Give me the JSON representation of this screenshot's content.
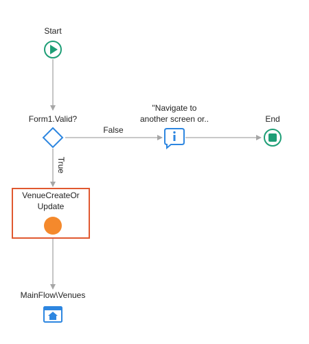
{
  "flow": {
    "start_label": "Start",
    "if_label": "Form1.Valid?",
    "message_label_line1": "\"Navigate to",
    "message_label_line2": "another screen or..",
    "end_label": "End",
    "false_label": "False",
    "true_label": "True",
    "action_label_line1": "VenueCreateOr",
    "action_label_line2": "Update",
    "destination_label": "MainFlow\\Venues"
  },
  "colors": {
    "connector": "#a6a6a6",
    "start_end": "#1e9e76",
    "if_node": "#2d86e0",
    "message_node": "#2d86e0",
    "action_node": "#f4892c",
    "selection_border": "#e0582f",
    "destination_node": "#2d86e0"
  },
  "icons": {
    "start": "play-icon",
    "if": "diamond-icon",
    "message": "info-message-icon",
    "end": "stop-icon",
    "action": "server-action-circle",
    "destination": "screen-home-icon"
  }
}
